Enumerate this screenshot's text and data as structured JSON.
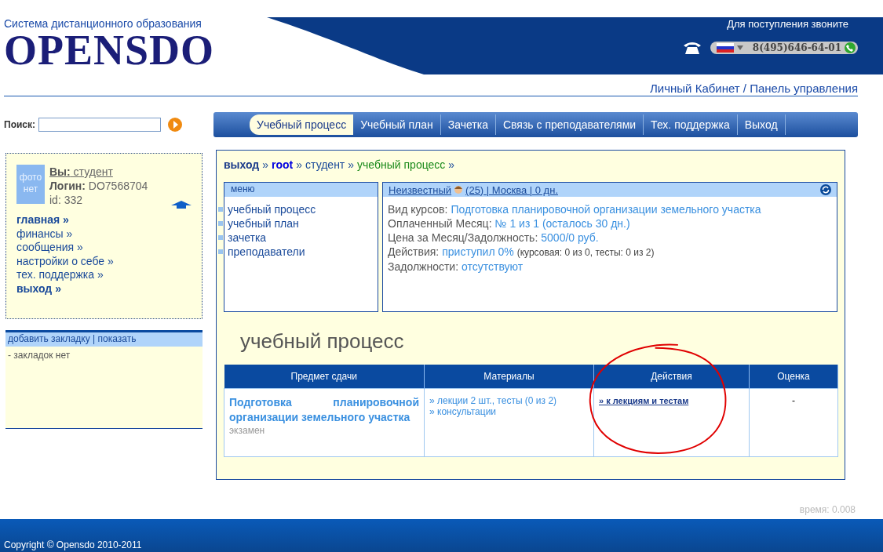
{
  "header": {
    "subtitle": "Система дистанционного образования",
    "logo": "OPENSDO",
    "call_text": "Для поступления звоните",
    "phone": "8(495)646-64-01",
    "cabinet_link": "Личный Кабинет / Панель управления"
  },
  "search": {
    "label": "Поиск:"
  },
  "nav": [
    {
      "label": "Учебный процесс",
      "selected": true
    },
    {
      "label": "Учебный план",
      "selected": false
    },
    {
      "label": "Зачетка",
      "selected": false
    },
    {
      "label": "Связь с преподавателями",
      "selected": false
    },
    {
      "label": "Тех. поддержка",
      "selected": false
    },
    {
      "label": "Выход",
      "selected": false
    }
  ],
  "profile": {
    "photo_text": "фото нет",
    "you_label": "Вы:",
    "you_value": "студент",
    "login_label": "Логин:",
    "login_value": "DO7568704",
    "id": "id: 332"
  },
  "side_menu": [
    {
      "label": "главная »",
      "bold": true
    },
    {
      "label": "финансы »",
      "bold": false
    },
    {
      "label": "сообщения »",
      "bold": false
    },
    {
      "label": "настройки о себе »",
      "bold": false
    },
    {
      "label": "тех. поддержка »",
      "bold": false
    },
    {
      "label": "выход »",
      "bold": true
    }
  ],
  "bookmarks": {
    "add_link": "добавить закладку",
    "divider": "|",
    "show_link": "показать",
    "empty": "- закладок нет"
  },
  "breadcrumb": {
    "separator": "»",
    "items": [
      {
        "label": "выход",
        "kind": "exit"
      },
      {
        "label": "root",
        "kind": "root"
      },
      {
        "label": "студент",
        "kind": "plain"
      },
      {
        "label": "учебный процесс",
        "kind": "current"
      }
    ]
  },
  "menu_box": {
    "title": "меню",
    "items": [
      "учебный процесс",
      "учебный план",
      "зачетка",
      "преподаватели"
    ]
  },
  "info_box": {
    "name": "Неизвестный",
    "details": "(25) | Москва | 0 дн.",
    "rows": [
      {
        "label": "Вид курсов:",
        "value": "Подготовка планировочной организации земельного участка"
      },
      {
        "label": "Оплаченный Месяц:",
        "value": "№ 1 из 1 (осталось 30 дн.)"
      },
      {
        "label": "Цена за Месяц/Задолжность:",
        "value": "5000/0 руб."
      },
      {
        "label": "Действия:",
        "value": "приступил 0%",
        "note": "(курсовая: 0 из 0, тесты: 0 из 2)"
      },
      {
        "label": "Задолжности:",
        "value": "отсутствуют"
      }
    ]
  },
  "section_title": "учебный процесс",
  "table": {
    "columns": [
      "Предмет сдачи",
      "Материалы",
      "Действия",
      "Оценка"
    ],
    "rows": [
      {
        "subject": "Подготовка планировочной организации земельного участка",
        "subject_type": "экзамен",
        "materials": [
          "» лекции 2 шт., тесты (0 из 2)",
          "» консультации"
        ],
        "action": "» к лекциям и тестам",
        "grade": "-"
      }
    ]
  },
  "time": "время: 0.008",
  "footer": "Copyright © Opensdo 2010-2011"
}
